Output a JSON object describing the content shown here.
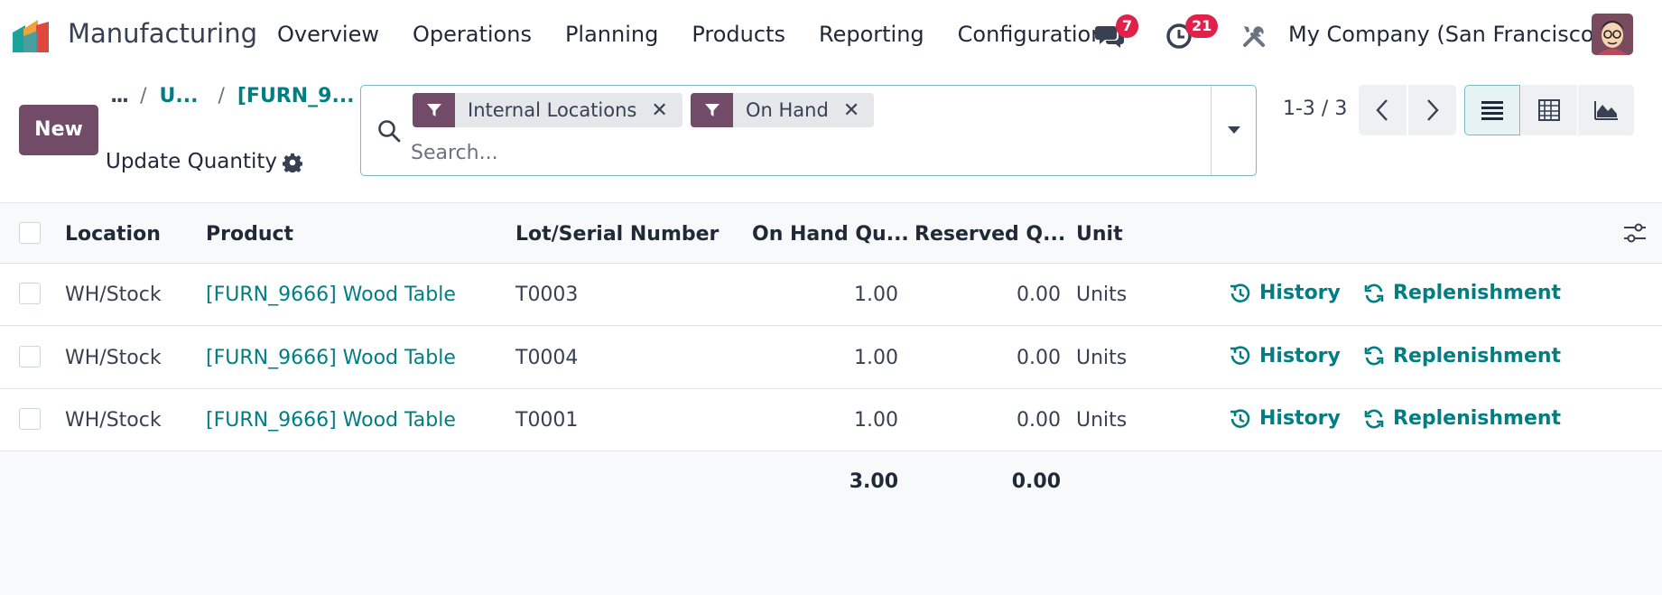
{
  "navbar": {
    "app_name": "Manufacturing",
    "menu": [
      "Overview",
      "Operations",
      "Planning",
      "Products",
      "Reporting",
      "Configuration"
    ],
    "messages_badge": "7",
    "activities_badge": "21",
    "company": "My Company (San Francisco)",
    "icons": [
      "app-logo-icon",
      "chat-icon",
      "clock-icon",
      "tools-icon",
      "avatar"
    ]
  },
  "control_panel": {
    "new_label": "New",
    "breadcrumb": {
      "dots": "...",
      "sep1": "/",
      "item1": "U...",
      "sep2": "/",
      "item2": "[FURN_9..."
    },
    "subtitle": "Update Quantity",
    "search": {
      "facets": [
        {
          "label": "Internal Locations"
        },
        {
          "label": "On Hand"
        }
      ],
      "placeholder": "Search..."
    },
    "pager": "1-3 / 3"
  },
  "list": {
    "columns": [
      "Location",
      "Product",
      "Lot/Serial Number",
      "On Hand Qu...",
      "Reserved Q...",
      "Unit"
    ],
    "rows": [
      {
        "location": "WH/Stock",
        "product": "[FURN_9666] Wood Table",
        "lot": "T0003",
        "on_hand": "1.00",
        "reserved": "0.00",
        "unit": "Units",
        "history": "History",
        "replenishment": "Replenishment"
      },
      {
        "location": "WH/Stock",
        "product": "[FURN_9666] Wood Table",
        "lot": "T0004",
        "on_hand": "1.00",
        "reserved": "0.00",
        "unit": "Units",
        "history": "History",
        "replenishment": "Replenishment"
      },
      {
        "location": "WH/Stock",
        "product": "[FURN_9666] Wood Table",
        "lot": "T0001",
        "on_hand": "1.00",
        "reserved": "0.00",
        "unit": "Units",
        "history": "History",
        "replenishment": "Replenishment"
      }
    ],
    "totals": {
      "on_hand": "3.00",
      "reserved": "0.00"
    }
  },
  "colors": {
    "brand": "#714b67",
    "link": "#017e84",
    "badge": "#e0224b"
  }
}
